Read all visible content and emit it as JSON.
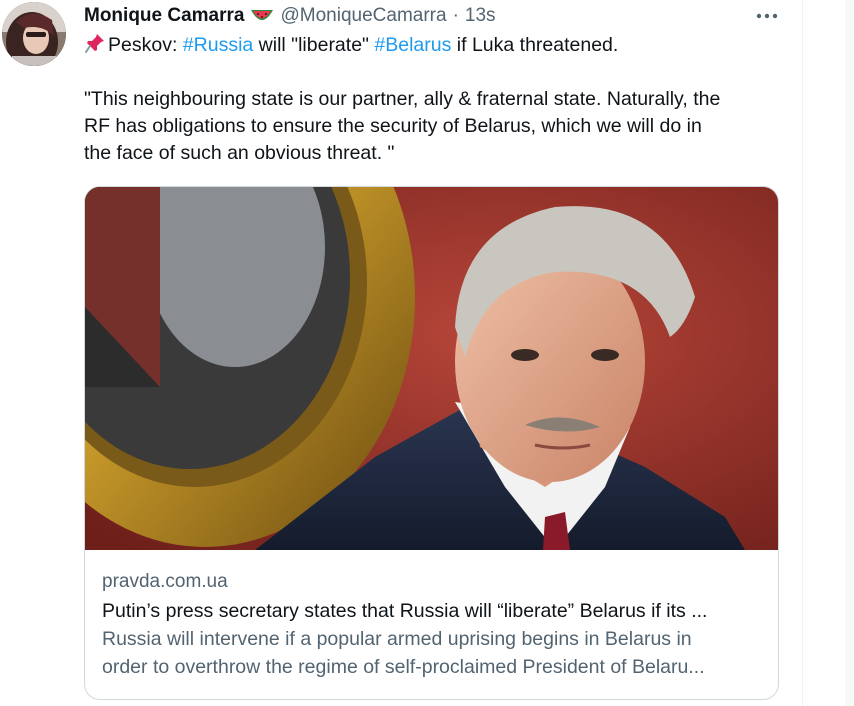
{
  "tweet": {
    "display_name": "Monique Camarra",
    "name_emoji": "watermelon-emoji",
    "handle": "@MoniqueCamarra",
    "separator": "·",
    "timestamp": "13s",
    "text_line1_prefix": "Peskov: ",
    "hashtag1": "#Russia",
    "text_line1_mid": " will \"liberate\" ",
    "hashtag2": "#Belarus",
    "text_line1_suffix": " if Luka threatened.",
    "quote_line1": "\"This neighbouring state is our partner, ally & fraternal state. Naturally, the",
    "quote_line2": "RF has obligations to ensure the security of Belarus, which we will do in",
    "quote_line3": "the face of such an obvious threat. \"",
    "pin_icon": "pushpin-emoji",
    "more_icon": "more-dots-icon"
  },
  "card": {
    "domain": "pravda.com.ua",
    "title": "Putin’s press secretary states that Russia will “liberate” Belarus if its ...",
    "desc_line1": "Russia will intervene if a popular armed uprising begins in Belarus in",
    "desc_line2": "order to overthrow the regime of self-proclaimed President of Belaru..."
  },
  "colors": {
    "link": "#1d9bf0",
    "secondary_text": "#536471",
    "primary_text": "#0f1419",
    "border": "#cfd9de"
  }
}
